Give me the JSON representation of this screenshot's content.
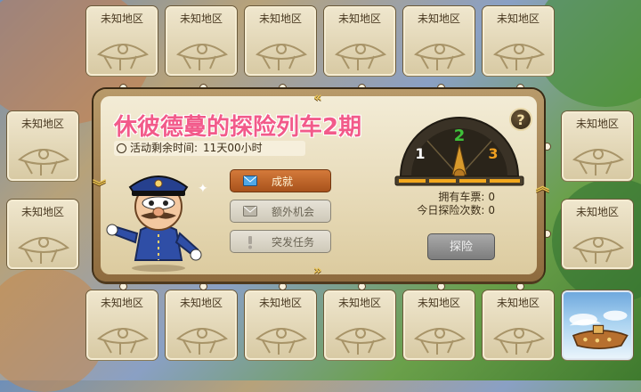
{
  "title": "休彼德蔓的探险列车2期",
  "timer": {
    "label": "活动剩余时间:",
    "value": "11天00小时"
  },
  "tiles": {
    "unknown_label": "未知地区"
  },
  "buttons": {
    "achievement": "成就",
    "extra_chance": "额外机会",
    "emergency_task": "突发任务",
    "explore": "探险"
  },
  "gauge": {
    "left": "1",
    "center": "2",
    "right": "3"
  },
  "stats": {
    "tickets_label": "拥有车票:",
    "tickets_value": "0",
    "explore_label": "今日探险次数:",
    "explore_value": "0"
  },
  "help": "?",
  "colors": {
    "title": "#f25a8a",
    "achievement_button": "#c0642a",
    "gauge_green": "#3ec03a",
    "gauge_orange": "#f0a020"
  }
}
